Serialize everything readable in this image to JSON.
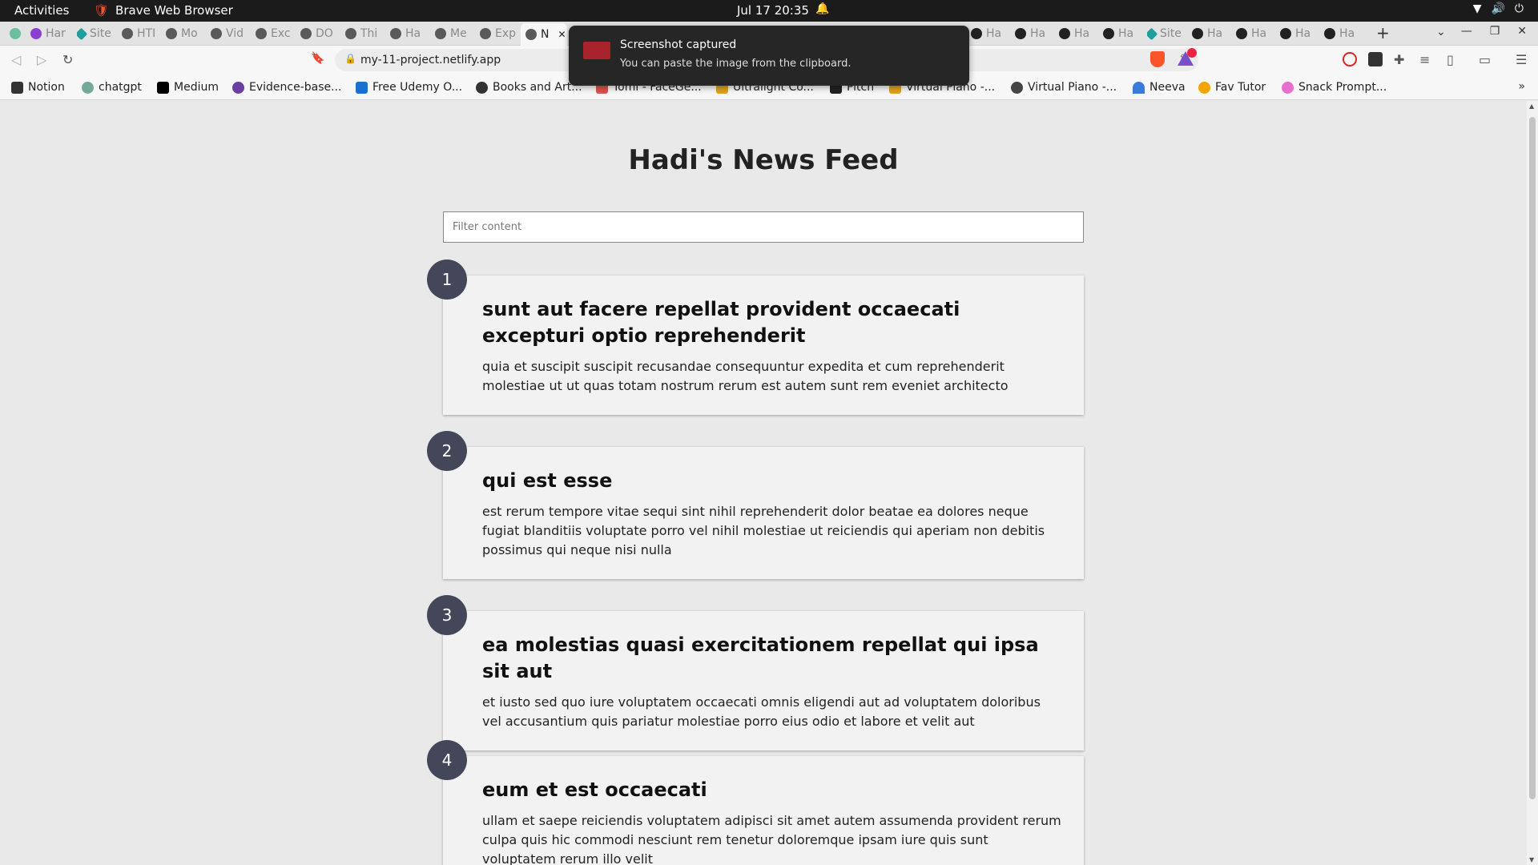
{
  "topbar": {
    "activities": "Activities",
    "app_name": "Brave Web Browser",
    "clock": "Jul 17  20:35"
  },
  "tabs": [
    {
      "label": "",
      "icon": "teal-icon"
    },
    {
      "label": "Har",
      "icon": "purple-icon"
    },
    {
      "label": "Site",
      "icon": "diamond-icon"
    },
    {
      "label": "HTI",
      "icon": "globe-icon"
    },
    {
      "label": "Mo",
      "icon": "globe-icon"
    },
    {
      "label": "Vid",
      "icon": "globe-icon"
    },
    {
      "label": "Exc",
      "icon": "globe-icon"
    },
    {
      "label": "DO",
      "icon": "globe-icon"
    },
    {
      "label": "Thi",
      "icon": "globe-icon"
    },
    {
      "label": "Ha",
      "icon": "globe-icon"
    },
    {
      "label": "Me",
      "icon": "globe-icon"
    },
    {
      "label": "Exp",
      "icon": "globe-icon"
    },
    {
      "label": "N",
      "icon": "globe-icon",
      "active": true
    },
    {
      "label": "Ha",
      "icon": "github-icon"
    },
    {
      "label": "Ha",
      "icon": "github-icon"
    },
    {
      "label": "Ha",
      "icon": "github-icon"
    },
    {
      "label": "Ha",
      "icon": "github-icon"
    },
    {
      "label": "Site",
      "icon": "diamond-icon"
    },
    {
      "label": "Ha",
      "icon": "github-icon"
    },
    {
      "label": "Ha",
      "icon": "github-icon"
    },
    {
      "label": "Ha",
      "icon": "github-icon"
    },
    {
      "label": "Ha",
      "icon": "github-icon"
    }
  ],
  "navbar": {
    "url": "my-11-project.netlify.app"
  },
  "bookmarks": [
    {
      "label": "Notion",
      "color": "#111111"
    },
    {
      "label": "chatgpt",
      "color": "#74aa9c"
    },
    {
      "label": "Medium",
      "color": "#000000"
    },
    {
      "label": "Evidence-base...",
      "color": "#6b3fa0"
    },
    {
      "label": "Free Udemy O...",
      "color": "#1b6fd1"
    },
    {
      "label": "Books and Art...",
      "color": "#333333"
    },
    {
      "label": "Tomi - FaceGe...",
      "color": "#d9534f"
    },
    {
      "label": "Ultralight Co...",
      "color": "#e0a020"
    },
    {
      "label": "Pitch",
      "color": "#222222"
    },
    {
      "label": "Virtual Piano -...",
      "color": "#e0a020"
    },
    {
      "label": "Virtual Piano -...",
      "color": "#444444"
    },
    {
      "label": "Neeva",
      "color": "#3a7bd5"
    },
    {
      "label": "Fav Tutor",
      "color": "#f0a500"
    },
    {
      "label": "Snack Prompt...",
      "color": "#e86fd0"
    }
  ],
  "notification": {
    "title": "Screenshot captured",
    "body": "You can paste the image from the clipboard."
  },
  "page": {
    "title": "Hadi's News Feed",
    "filter_placeholder": "Filter content",
    "posts": [
      {
        "number": "1",
        "title": "sunt aut facere repellat provident occaecati excepturi optio reprehenderit",
        "body": "quia et suscipit suscipit recusandae consequuntur expedita et cum reprehenderit molestiae ut ut quas totam nostrum rerum est autem sunt rem eveniet architecto"
      },
      {
        "number": "2",
        "title": "qui est esse",
        "body": "est rerum tempore vitae sequi sint nihil reprehenderit dolor beatae ea dolores neque fugiat blanditiis voluptate porro vel nihil molestiae ut reiciendis qui aperiam non debitis possimus qui neque nisi nulla"
      },
      {
        "number": "3",
        "title": "ea molestias quasi exercitationem repellat qui ipsa sit aut",
        "body": "et iusto sed quo iure voluptatem occaecati omnis eligendi aut ad voluptatem doloribus vel accusantium quis pariatur molestiae porro eius odio et labore et velit aut"
      },
      {
        "number": "4",
        "title": "eum et est occaecati",
        "body": "ullam et saepe reiciendis voluptatem adipisci sit amet autem assumenda provident rerum culpa quis hic commodi nesciunt rem tenetur doloremque ipsam iure quis sunt voluptatem rerum illo velit"
      }
    ]
  }
}
